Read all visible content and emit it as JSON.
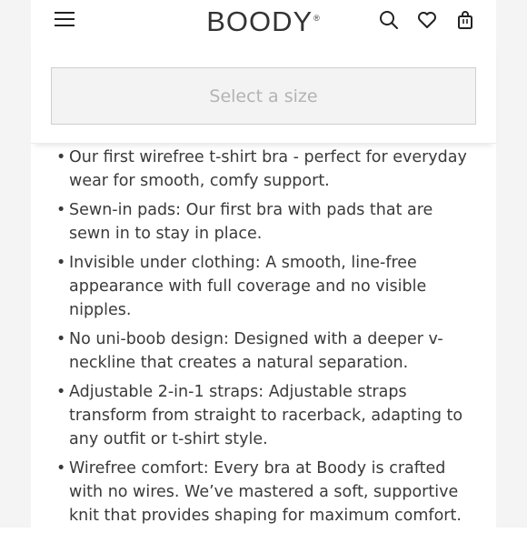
{
  "header": {
    "logo": "BOODY",
    "logo_mark": "®",
    "icons": [
      "hamburger-menu-icon",
      "search-icon",
      "heart-icon",
      "shopping-bag-icon"
    ]
  },
  "size_selector": {
    "label": "Select a size"
  },
  "features": [
    "Our first wirefree t-shirt bra - perfect for everyday wear for smooth, comfy support.",
    "Sewn-in pads: Our first bra with pads that are sewn in to stay in place.",
    "Invisible under clothing: A smooth, line-free appearance with full coverage and no visible nipples.",
    "No uni-boob design: Designed with a deeper v-neckline that creates a natural separation.",
    "Adjustable 2-in-1 straps: Adjustable straps transform from straight to racerback, adapting to any outfit or t-shirt style.",
    "Wirefree comfort: Every bra at Boody is crafted with no wires. We’ve mastered a soft, supportive knit that provides shaping for maximum comfort."
  ],
  "colors": {
    "text": "#3a3a3a",
    "select_bg": "#f3f3f3",
    "select_text": "#b3b3b3"
  }
}
